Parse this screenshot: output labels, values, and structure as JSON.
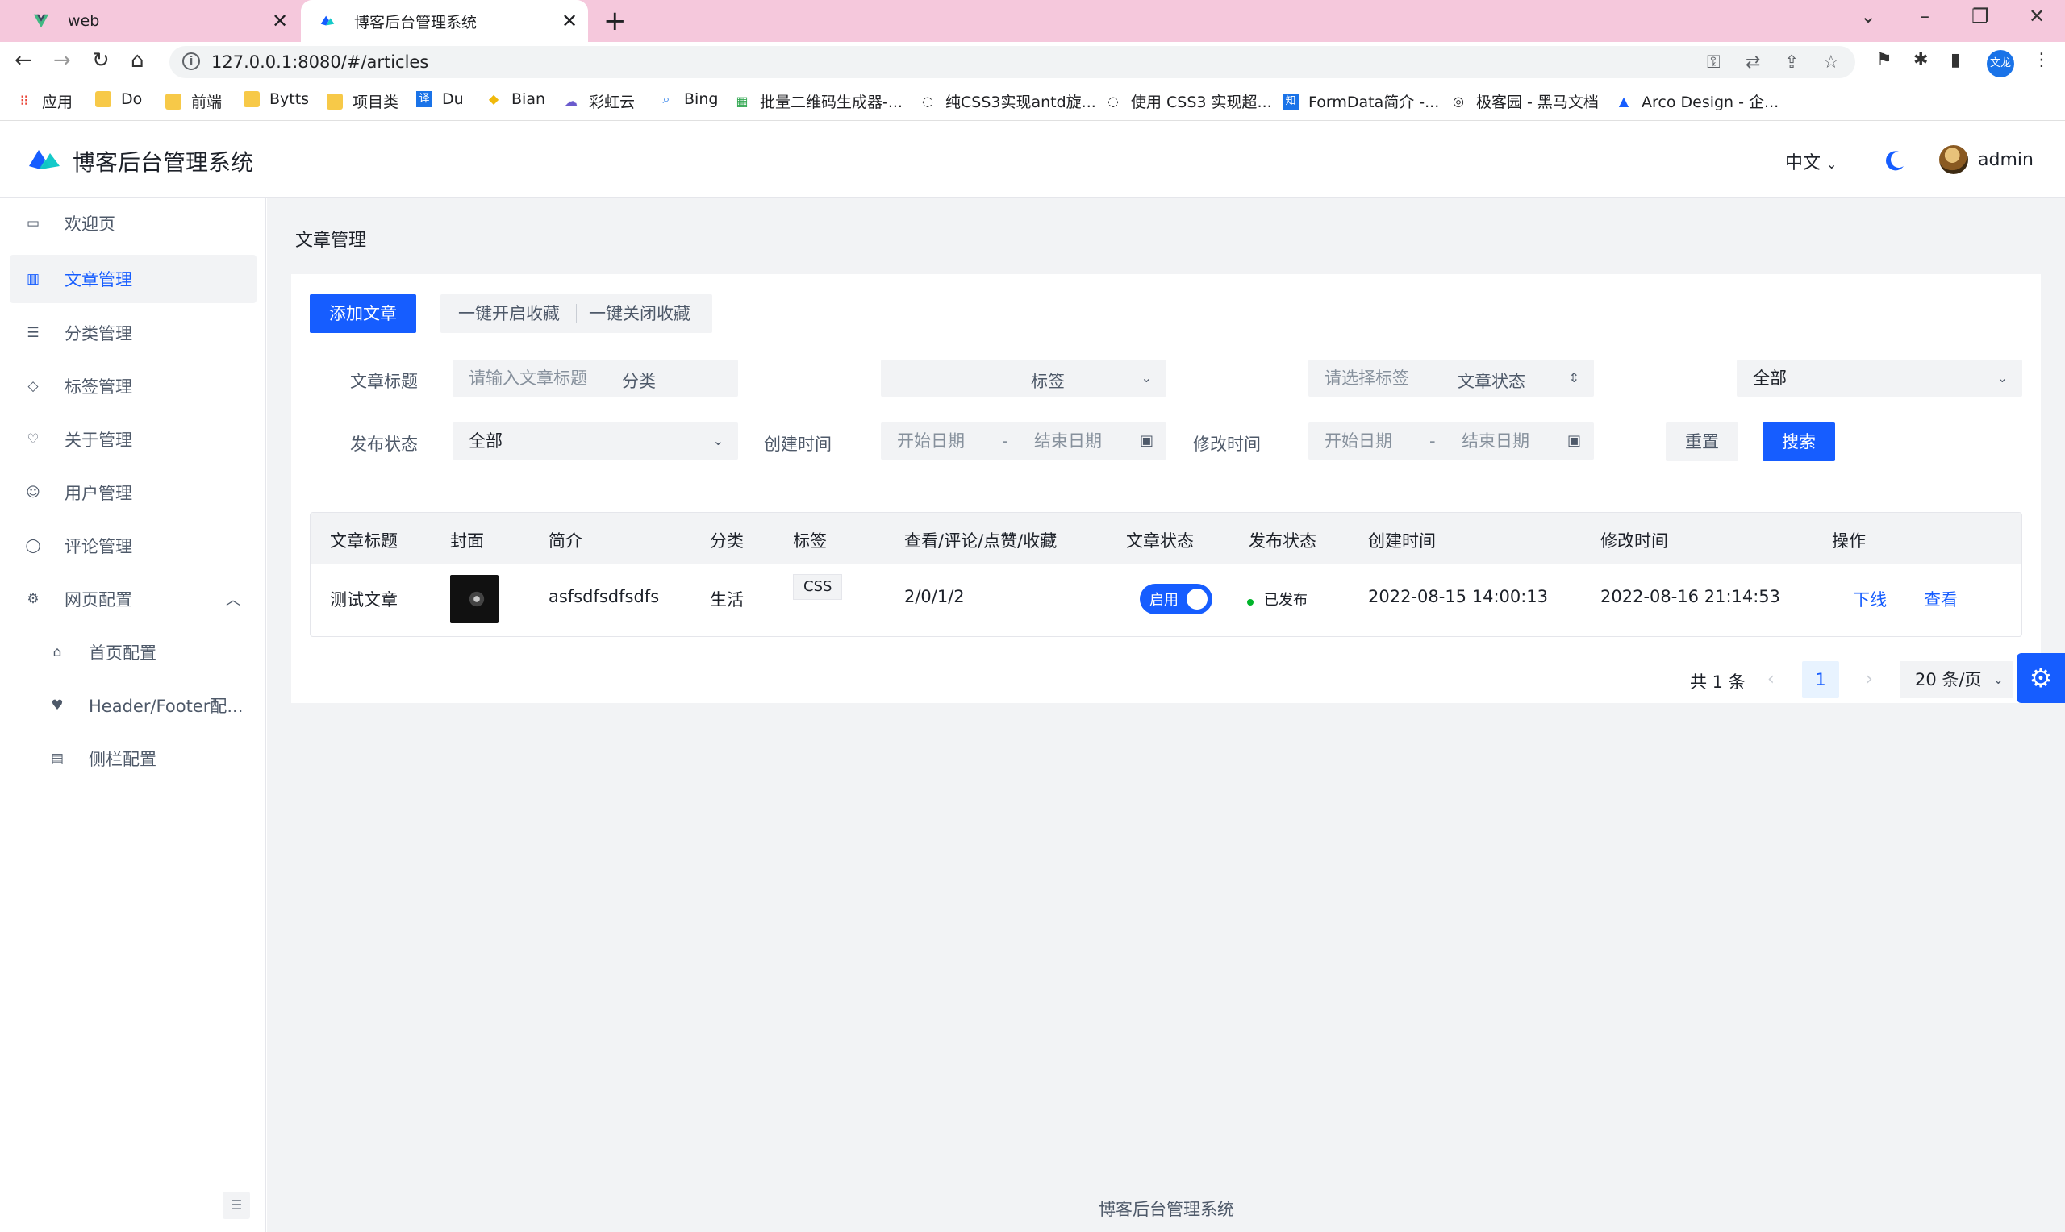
{
  "browser": {
    "tabs": [
      {
        "title": "web"
      },
      {
        "title": "博客后台管理系统"
      }
    ],
    "url": "127.0.0.1:8080/#/articles",
    "profile_label": "文龙",
    "bookmarks": [
      {
        "label": "应用"
      },
      {
        "label": "Do"
      },
      {
        "label": "前端"
      },
      {
        "label": "Bytts"
      },
      {
        "label": "项目类"
      },
      {
        "label": "Du"
      },
      {
        "label": "Bian"
      },
      {
        "label": "彩虹云"
      },
      {
        "label": "Bing"
      },
      {
        "label": "批量二维码生成器-..."
      },
      {
        "label": "纯CSS3实现antd旋..."
      },
      {
        "label": "使用 CSS3 实现超..."
      },
      {
        "label": "FormData简介 -..."
      },
      {
        "label": "极客园 - 黑马文档"
      },
      {
        "label": "Arco Design - 企..."
      }
    ]
  },
  "header": {
    "title": "博客后台管理系统",
    "language": "中文",
    "username": "admin"
  },
  "sidebar": {
    "items": [
      {
        "label": "欢迎页"
      },
      {
        "label": "文章管理"
      },
      {
        "label": "分类管理"
      },
      {
        "label": "标签管理"
      },
      {
        "label": "关于管理"
      },
      {
        "label": "用户管理"
      },
      {
        "label": "评论管理"
      },
      {
        "label": "网页配置"
      },
      {
        "label": "首页配置"
      },
      {
        "label": "Header/Footer配..."
      },
      {
        "label": "侧栏配置"
      }
    ]
  },
  "main": {
    "breadcrumb": "文章管理",
    "actions": {
      "add": "添加文章",
      "enable_fav": "一键开启收藏",
      "disable_fav": "一键关闭收藏"
    },
    "filters": {
      "title_label": "文章标题",
      "title_placeholder": "请输入文章标题",
      "category_label": "分类",
      "tag_label": "标签",
      "tag_placeholder": "请选择标签",
      "status_label": "文章状态",
      "status_value": "全部",
      "publish_label": "发布状态",
      "publish_value": "全部",
      "created_label": "创建时间",
      "modified_label": "修改时间",
      "start_placeholder": "开始日期",
      "end_placeholder": "结束日期",
      "range_sep": "-",
      "reset": "重置",
      "search": "搜索"
    },
    "table": {
      "columns": [
        "文章标题",
        "封面",
        "简介",
        "分类",
        "标签",
        "查看/评论/点赞/收藏",
        "文章状态",
        "发布状态",
        "创建时间",
        "修改时间",
        "操作"
      ],
      "rows": [
        {
          "title": "测试文章",
          "summary": "asfsdfsdfsdfs",
          "category": "生活",
          "tag": "CSS",
          "stats": "2/0/1/2",
          "status_switch": "启用",
          "publish": "已发布",
          "created": "2022-08-15 14:00:13",
          "modified": "2022-08-16 21:14:53",
          "action_offline": "下线",
          "action_view": "查看"
        }
      ]
    },
    "pagination": {
      "total": "共 1 条",
      "current": "1",
      "page_size": "20 条/页"
    }
  },
  "footer": {
    "text": "博客后台管理系统"
  },
  "colors": {
    "primary": "#165dff",
    "tab_bar": "#f5c8dc",
    "content_bg": "#f2f3f5",
    "published_dot": "#00b42a"
  }
}
